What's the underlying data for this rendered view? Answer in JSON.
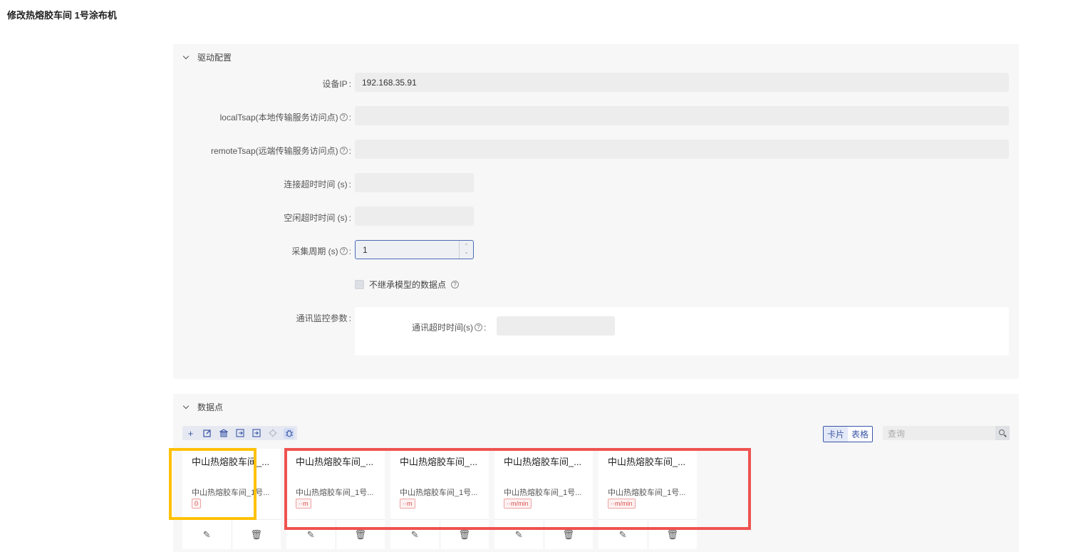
{
  "page": {
    "title": "修改热熔胶车间 1号涂布机"
  },
  "driver_section": {
    "title": "驱动配置",
    "fields": {
      "device_ip": {
        "label": "设备IP",
        "value": "192.168.35.91"
      },
      "local_tsap": {
        "label": "localTsap(本地传输服务访问点)",
        "value": ""
      },
      "remote_tsap": {
        "label": "remoteTsap(远端传输服务访问点)",
        "value": ""
      },
      "connect_timeout": {
        "label": "连接超时时间 (s)",
        "value": ""
      },
      "idle_timeout": {
        "label": "空闲超时时间 (s)",
        "value": ""
      },
      "collect_period": {
        "label": "采集周期 (s)",
        "value": "1"
      }
    },
    "checkbox_label": "不继承模型的数据点",
    "monitor": {
      "label": "通讯监控参数",
      "timeout_label": "通讯超时时间(s)",
      "timeout_value": ""
    },
    "colon": ":",
    "help_glyph": "?"
  },
  "datapoints_section": {
    "title": "数据点",
    "toolbar_icons": [
      "add-icon",
      "edit-icon",
      "bank-icon",
      "import-icon",
      "export-icon",
      "locate-icon",
      "debug-icon"
    ],
    "view_toggle": {
      "card": "卡片",
      "table": "表格",
      "active": "card"
    },
    "search": {
      "placeholder": "查询"
    },
    "cards": [
      {
        "title": "中山热熔胶车间_...",
        "subtitle": "中山热熔胶车间_1号...",
        "tag": "0"
      },
      {
        "title": "中山热熔胶车间_...",
        "subtitle": "中山热熔胶车间_1号...",
        "tag": "··m"
      },
      {
        "title": "中山热熔胶车间_...",
        "subtitle": "中山热熔胶车间_1号...",
        "tag": "··m"
      },
      {
        "title": "中山热熔胶车间_...",
        "subtitle": "中山热熔胶车间_1号...",
        "tag": "··m/min"
      },
      {
        "title": "中山热熔胶车间_...",
        "subtitle": "中山热熔胶车间_1号...",
        "tag": "··m/min"
      }
    ]
  },
  "highlight_colors": {
    "yellow": "#ffc107",
    "red": "#ef5350"
  }
}
